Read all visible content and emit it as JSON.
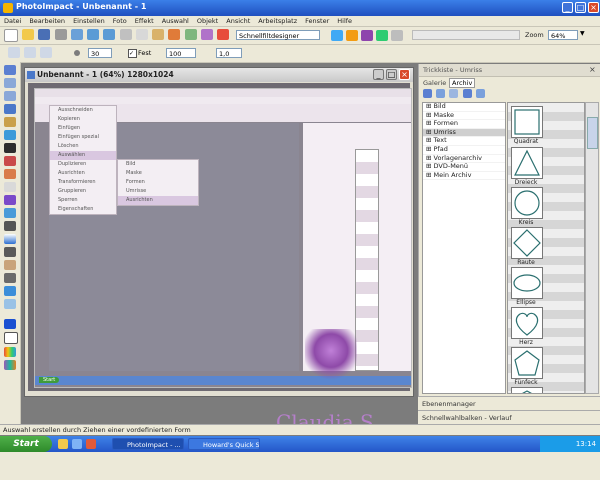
{
  "window": {
    "title": "PhotoImpact - Unbenannt - 1"
  },
  "menu": [
    "Datei",
    "Bearbeiten",
    "Einstellen",
    "Foto",
    "Effekt",
    "Auswahl",
    "Objekt",
    "Ansicht",
    "Arbeitsplatz",
    "Fenster",
    "Hilfe"
  ],
  "toolbar": {
    "tool_value": "Schnellfiltdesigner",
    "zoom_label": "Zoom",
    "zoom_value": "64%"
  },
  "attrbar": {
    "size_value": "30",
    "mode_label": "Fest",
    "value_a": "100",
    "value_b": "1,0"
  },
  "document": {
    "title": "Unbenannt - 1 (64%) 1280x1024"
  },
  "embedded": {
    "menu_rows": [
      "Ausschneiden",
      "Kopieren",
      "Einfügen",
      "Einfügen spezial",
      "Löschen",
      "Auswählen",
      "Duplizieren",
      "Ausrichten",
      "Transformieren",
      "Gruppieren",
      "Sperren",
      "Eigenschaften"
    ],
    "submenu_rows": [
      "Bild",
      "Maske",
      "Formen",
      "Umrisse"
    ],
    "highlight_row": "Ausrichten",
    "taskbar_start": "Start"
  },
  "panel": {
    "title": "Trickkiste - Umriss",
    "tabs": [
      "Galerie",
      "Archiv"
    ],
    "tree": [
      {
        "label": "Bild",
        "selected": false
      },
      {
        "label": "Maske",
        "selected": false
      },
      {
        "label": "Formen",
        "selected": false
      },
      {
        "label": "Umriss",
        "selected": true
      },
      {
        "label": "Text",
        "selected": false
      },
      {
        "label": "Pfad",
        "selected": false
      },
      {
        "label": "Vorlagenarchiv",
        "selected": false
      },
      {
        "label": "DVD-Menü",
        "selected": false
      },
      {
        "label": "Mein Archiv",
        "selected": false
      }
    ],
    "shapes": [
      {
        "label": "Quadrat",
        "icon": "square-shape-icon"
      },
      {
        "label": "Dreieck",
        "icon": "triangle-shape-icon"
      },
      {
        "label": "Kreis",
        "icon": "circle-shape-icon"
      },
      {
        "label": "Raute",
        "icon": "diamond-shape-icon"
      },
      {
        "label": "Ellipse",
        "icon": "ellipse-shape-icon"
      },
      {
        "label": "Herz",
        "icon": "heart-shape-icon"
      },
      {
        "label": "Fünfeck",
        "icon": "pentagon-shape-icon"
      },
      {
        "label": "",
        "icon": "hexagon-shape-icon"
      }
    ]
  },
  "bottom_panels": [
    "Ebenenmanager",
    "Schnellwahlbalken - Verlauf"
  ],
  "status": {
    "text": "Auswahl erstellen durch Ziehen einer vordefinierten Form"
  },
  "taskbar": {
    "start": "Start",
    "tasks": [
      "PhotoImpact - ...",
      "Howard's Quick S..."
    ],
    "time": "13:14"
  },
  "watermark": "Claudia S."
}
